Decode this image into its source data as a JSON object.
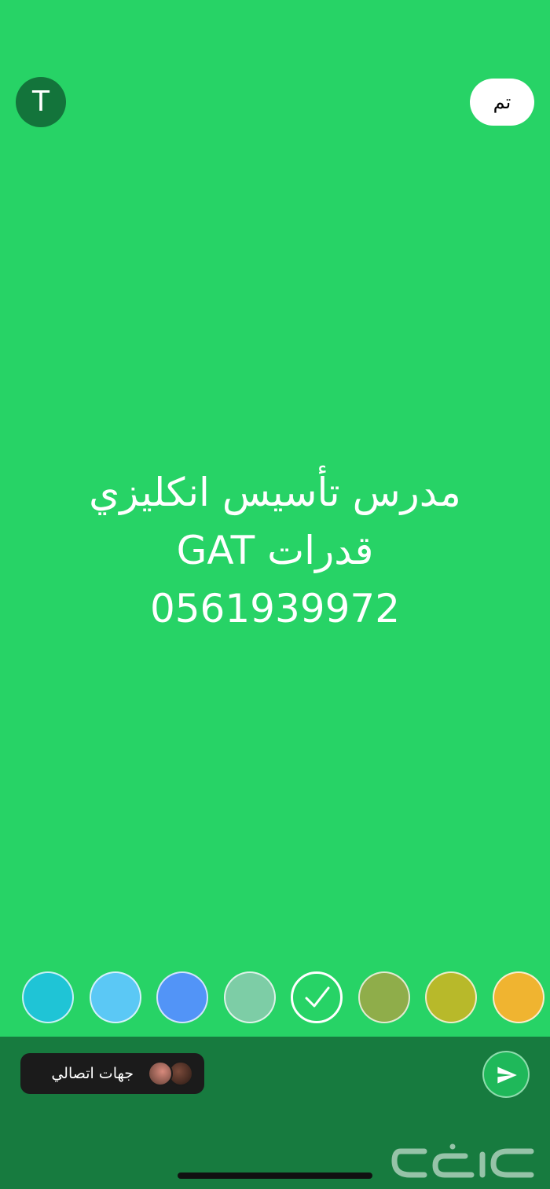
{
  "header": {
    "font_toggle_label": "T",
    "done_label": "تم"
  },
  "status": {
    "line1": "مدرس تأسيس انكليزي",
    "line2": "قدرات GAT",
    "line3": "0561939972",
    "background_color": "#27d366",
    "text_color": "#ffffff"
  },
  "color_palette": {
    "swatches": [
      "#1fc4d6",
      "#5bc8f5",
      "#5294f7",
      "#7dcda6",
      "#27d366",
      "#8fad4a",
      "#b8b92a",
      "#f0b430"
    ],
    "selected_index": 4
  },
  "footer": {
    "audience_label": "جهات اتصالي",
    "send_icon": "send-arrow-icon",
    "bar_color": "#177b3f"
  }
}
